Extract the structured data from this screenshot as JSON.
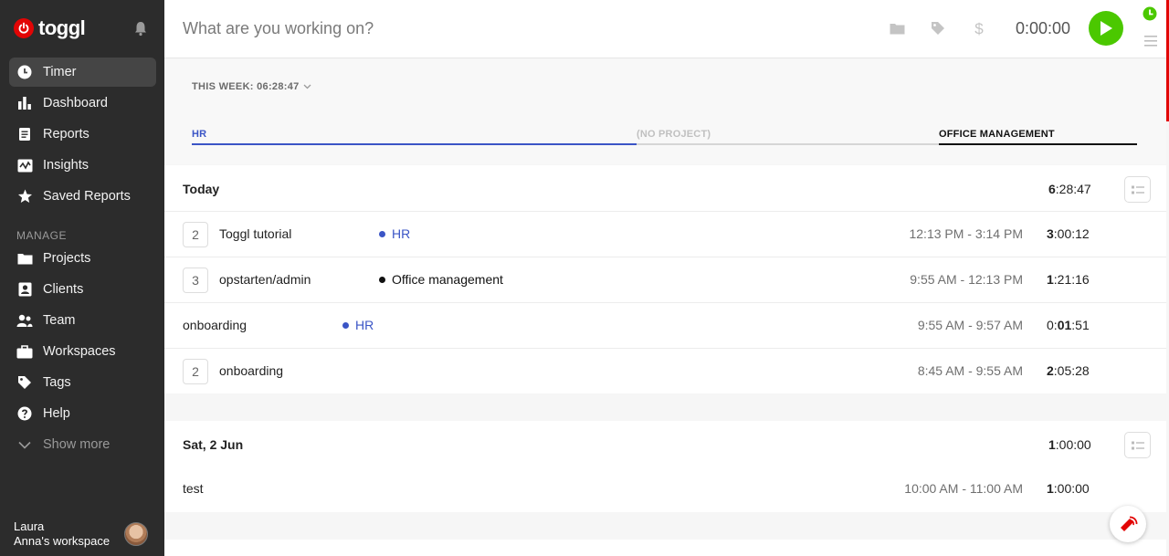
{
  "brand": {
    "name": "toggl",
    "color": "#e20505"
  },
  "sidebar": {
    "items": [
      {
        "label": "Timer",
        "icon": "clock-icon",
        "active": true
      },
      {
        "label": "Dashboard",
        "icon": "bar-chart-icon"
      },
      {
        "label": "Reports",
        "icon": "document-icon"
      },
      {
        "label": "Insights",
        "icon": "insights-icon"
      },
      {
        "label": "Saved Reports",
        "icon": "star-icon"
      }
    ],
    "manage_label": "MANAGE",
    "manage_items": [
      {
        "label": "Projects",
        "icon": "folder-icon"
      },
      {
        "label": "Clients",
        "icon": "client-icon"
      },
      {
        "label": "Team",
        "icon": "team-icon"
      },
      {
        "label": "Workspaces",
        "icon": "briefcase-icon"
      },
      {
        "label": "Tags",
        "icon": "tag-icon"
      },
      {
        "label": "Help",
        "icon": "help-icon"
      },
      {
        "label": "Show more",
        "icon": "chevron-down-icon"
      }
    ],
    "user": {
      "name": "Laura",
      "workspace": "Anna's workspace"
    }
  },
  "timer": {
    "placeholder": "What are you working on?",
    "elapsed": "0:00:00",
    "play_color": "#4bc800"
  },
  "week": {
    "total_label": "THIS WEEK: 06:28:47",
    "projects": [
      {
        "label": "HR",
        "color": "#3b55c6",
        "share": 0.47
      },
      {
        "label": "(NO PROJECT)",
        "color": "#c8c8c8",
        "share": 0.33
      },
      {
        "label": "OFFICE MANAGEMENT",
        "color": "#111111",
        "share": 0.2
      }
    ]
  },
  "days": [
    {
      "title": "Today",
      "total_bold": "6",
      "total_rest": ":28:47",
      "entries": [
        {
          "count": "2",
          "desc": "Toggl tutorial",
          "project": "HR",
          "project_color": "#3b55c6",
          "range": "12:13 PM - 3:14 PM",
          "dur_bold": "3",
          "dur_rest": ":00:12"
        },
        {
          "count": "3",
          "desc": "opstarten/admin",
          "project": "Office management",
          "project_color": "#111111",
          "range": "9:55 AM - 12:13 PM",
          "dur_bold": "1",
          "dur_rest": ":21:16"
        },
        {
          "count": "",
          "desc": "onboarding",
          "project": "HR",
          "project_color": "#3b55c6",
          "range": "9:55 AM - 9:57 AM",
          "dur_pre": "0:",
          "dur_bold": "01",
          "dur_rest": ":51"
        },
        {
          "count": "2",
          "desc": "onboarding",
          "project": "",
          "project_color": "",
          "range": "8:45 AM - 9:55 AM",
          "dur_bold": "2",
          "dur_rest": ":05:28"
        }
      ]
    },
    {
      "title": "Sat, 2 Jun",
      "total_bold": "1",
      "total_rest": ":00:00",
      "entries": [
        {
          "count": "",
          "desc": "test",
          "project": "",
          "project_color": "",
          "range": "10:00 AM - 11:00 AM",
          "dur_bold": "1",
          "dur_rest": ":00:00"
        }
      ]
    }
  ]
}
